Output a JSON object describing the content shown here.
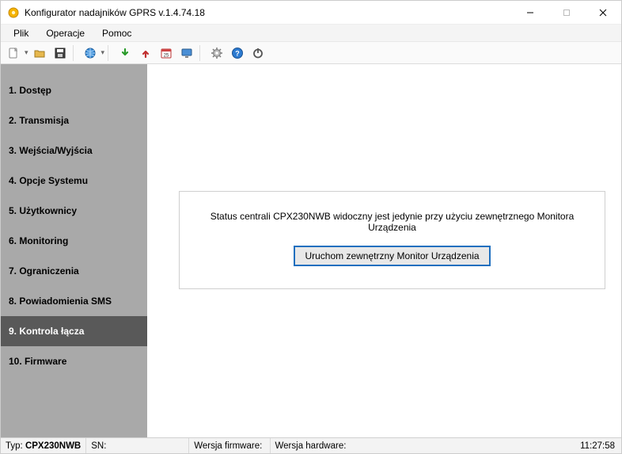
{
  "window": {
    "title": "Konfigurator nadajników GPRS v.1.4.74.18"
  },
  "menu": {
    "items": [
      {
        "label": "Plik"
      },
      {
        "label": "Operacje"
      },
      {
        "label": "Pomoc"
      }
    ]
  },
  "toolbar": {
    "icons": [
      "new-file",
      "open-folder",
      "save",
      "globe",
      "download",
      "upload",
      "calendar",
      "monitor",
      "gear",
      "help",
      "power"
    ]
  },
  "sidebar": {
    "items": [
      {
        "label": "1. Dostęp"
      },
      {
        "label": "2. Transmisja"
      },
      {
        "label": "3. Wejścia/Wyjścia"
      },
      {
        "label": "4. Opcje Systemu"
      },
      {
        "label": "5. Użytkownicy"
      },
      {
        "label": "6. Monitoring"
      },
      {
        "label": "7. Ograniczenia"
      },
      {
        "label": "8. Powiadomienia SMS"
      },
      {
        "label": "9. Kontrola łącza"
      },
      {
        "label": "10. Firmware"
      }
    ],
    "selected_index": 8
  },
  "main": {
    "status_message": "Status centrali CPX230NWB widoczny jest jedynie przy użyciu zewnętrznego Monitora Urządzenia",
    "launch_button": "Uruchom zewnętrzny Monitor Urządzenia"
  },
  "statusbar": {
    "type_label": "Typ:",
    "type_value": "CPX230NWB",
    "sn_label": "SN:",
    "sn_value": "",
    "fw_label": "Wersja firmware:",
    "fw_value": "",
    "hw_label": "Wersja hardware:",
    "hw_value": "",
    "time": "11:27:58"
  }
}
